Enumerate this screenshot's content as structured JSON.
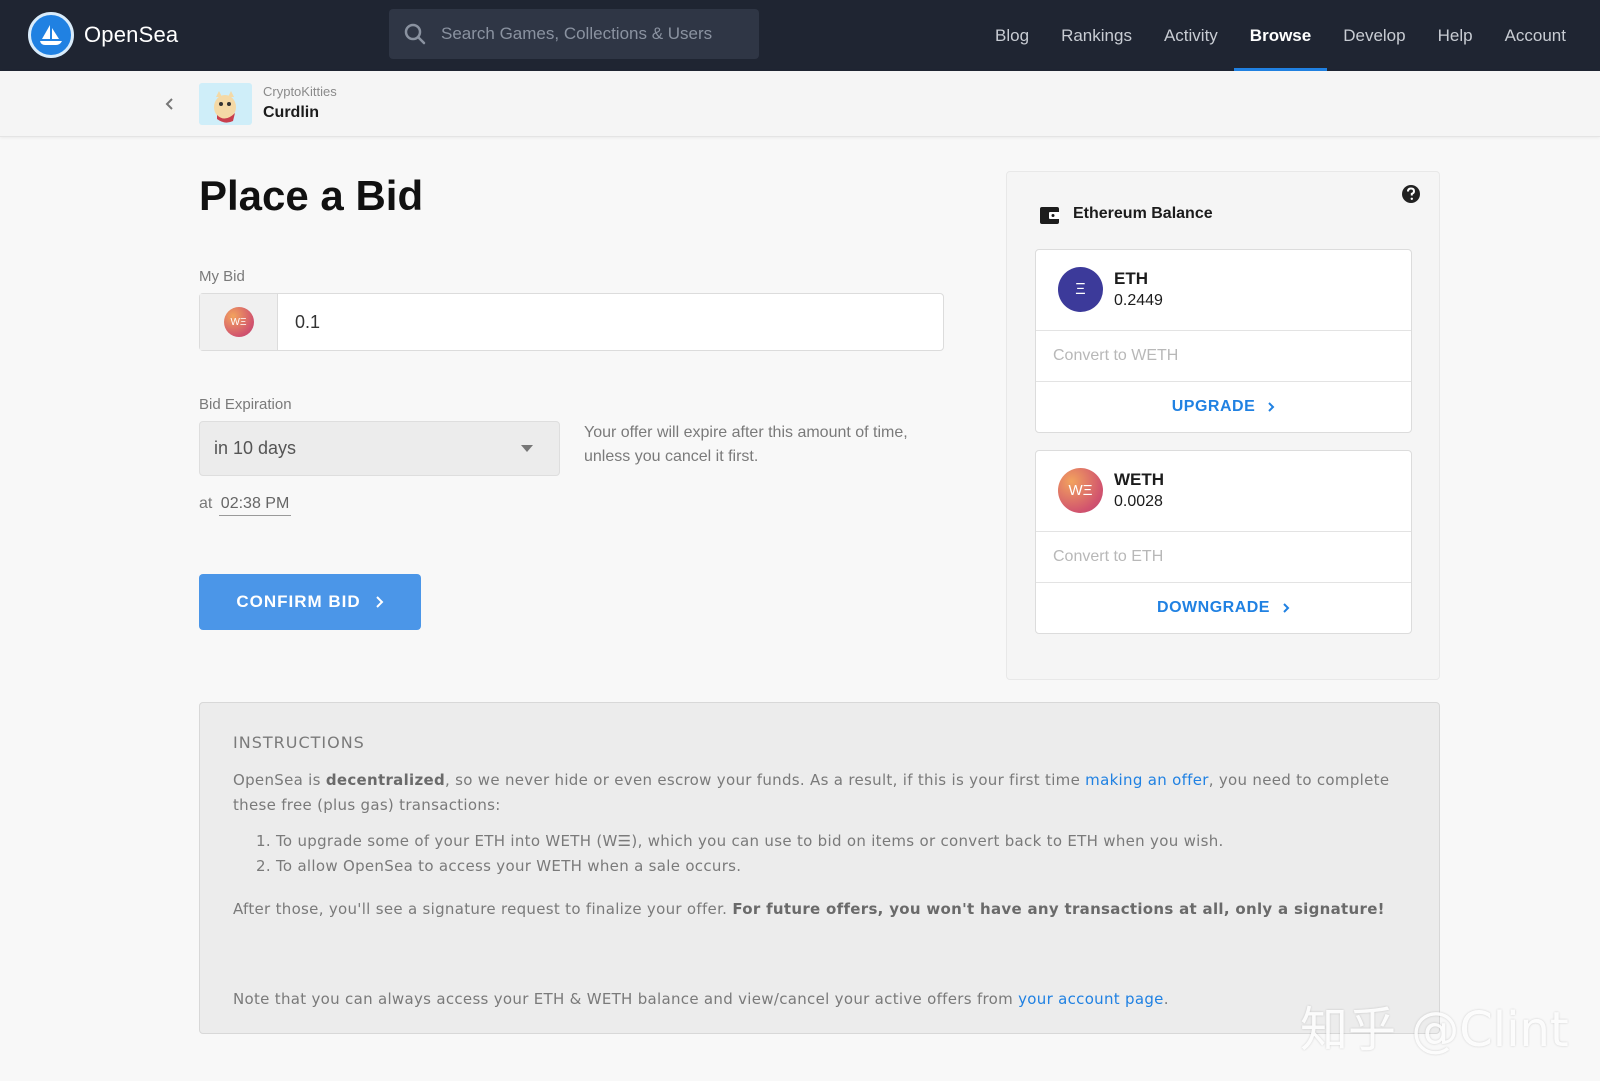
{
  "app": {
    "name": "OpenSea",
    "search_placeholder": "Search Games, Collections & Users",
    "nav": [
      {
        "label": "Blog",
        "active": false
      },
      {
        "label": "Rankings",
        "active": false
      },
      {
        "label": "Activity",
        "active": false
      },
      {
        "label": "Browse",
        "active": true
      },
      {
        "label": "Develop",
        "active": false
      },
      {
        "label": "Help",
        "active": false
      },
      {
        "label": "Account",
        "active": false
      }
    ],
    "accent_color": "#2081e2"
  },
  "breadcrumb": {
    "collection": "CryptoKitties",
    "item": "Curdlin"
  },
  "page": {
    "title": "Place a Bid",
    "my_bid_label": "My Bid",
    "bid_token_icon_text": "WΞ",
    "bid_value": "0.1",
    "expiration_label": "Bid Expiration",
    "expiration_value": "in 10 days",
    "expiration_note": "Your offer will expire after this amount of time, unless you cancel it first.",
    "at_label": "at",
    "at_time": "02:38 PM",
    "confirm_label": "CONFIRM BID"
  },
  "balance": {
    "title": "Ethereum Balance",
    "tokens": [
      {
        "symbol": "ETH",
        "icon_text": "Ξ",
        "amount": "0.2449",
        "convert_placeholder": "Convert to WETH",
        "action": "UPGRADE"
      },
      {
        "symbol": "WETH",
        "icon_text": "WΞ",
        "amount": "0.0028",
        "convert_placeholder": "Convert to ETH",
        "action": "DOWNGRADE"
      }
    ]
  },
  "instructions": {
    "heading": "INSTRUCTIONS",
    "p1_a": "OpenSea is ",
    "p1_bold": "decentralized",
    "p1_b": ", so we never hide or even escrow your funds. As a result, if this is your first time ",
    "p1_link": "making an offer",
    "p1_c": ", you need to complete these free (plus gas) transactions:",
    "steps": [
      "1. To upgrade some of your ETH into WETH (W☰), which you can use to bid on items or convert back to ETH when you wish.",
      "2. To allow OpenSea to access your WETH when a sale occurs."
    ],
    "p2_a": "After those, you'll see a signature request to finalize your offer. ",
    "p2_bold": "For future offers, you won't have any transactions at all, only a signature!",
    "p3_a": "Note that you can always access your ETH & WETH balance and view/cancel your active offers from ",
    "p3_link": "your account page",
    "p3_b": "."
  },
  "watermark": "知乎 @Clint"
}
